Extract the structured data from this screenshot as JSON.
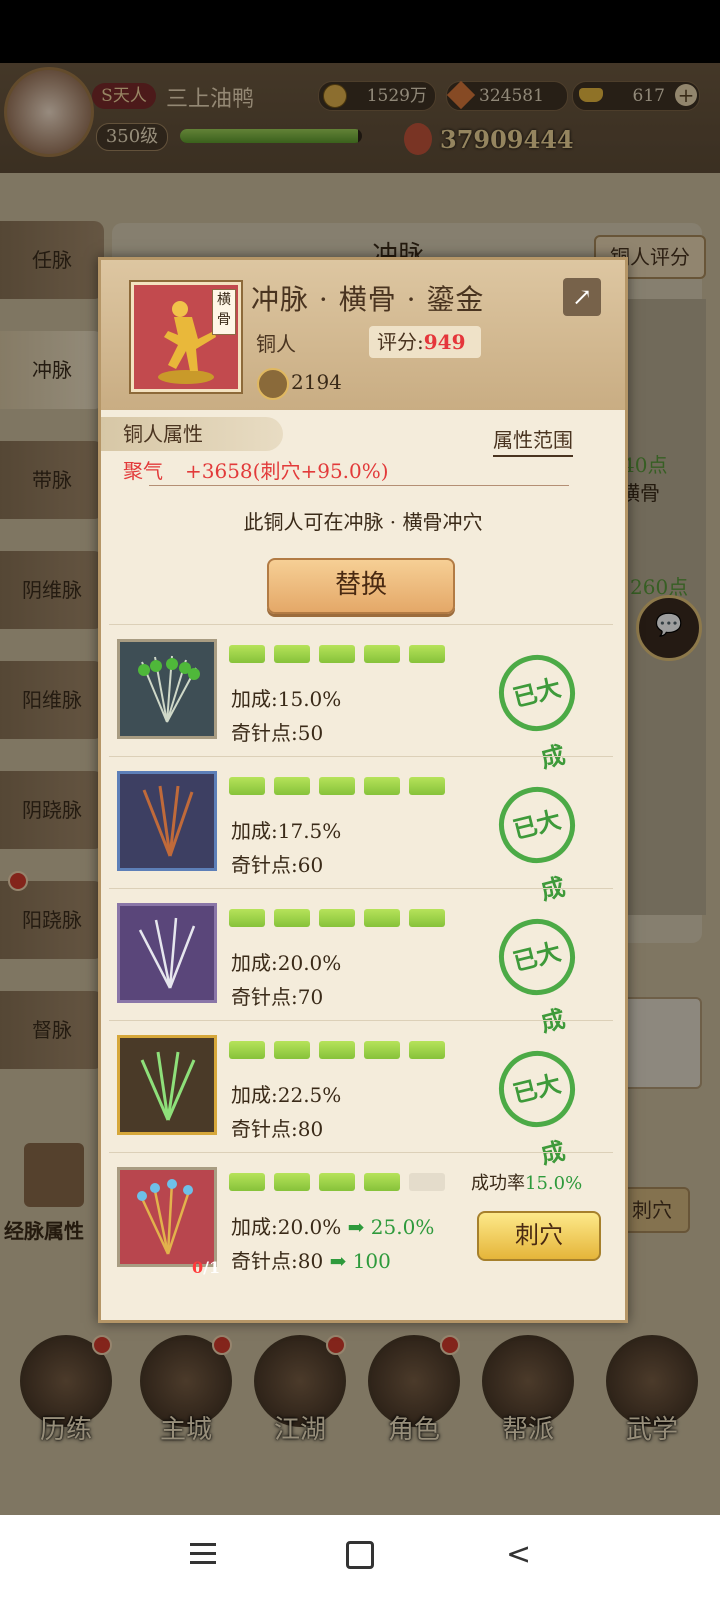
{
  "header": {
    "vip_label": "S天人",
    "player_name": "三上油鸭",
    "level": "350级",
    "power": "37909444",
    "level_progress": 0.98
  },
  "currencies": {
    "coins": "1529万",
    "gems": "324581",
    "gold": "617"
  },
  "side_tabs": [
    "任脉",
    "冲脉",
    "带脉",
    "阴维脉",
    "阳维脉",
    "阴跷脉",
    "阳跷脉",
    "督脉"
  ],
  "background": {
    "panel_title": "冲脉",
    "rating_button": "铜人评分",
    "meridian_attr": "经脉属性",
    "bg_points_1": "40点",
    "bg_label_1": "横骨",
    "bg_points_2": "260点",
    "bg_pierce": "刺穴"
  },
  "bottom_nav": [
    "历练",
    "主城",
    "江湖",
    "角色",
    "帮派",
    "武学"
  ],
  "dialog": {
    "title": "冲脉 · 横骨 · 鎏金",
    "portrait_tag": "横骨",
    "type": "铜人",
    "score_label": "评分:",
    "score_value": "949",
    "item_count": "2194",
    "section_tab": "铜人属性",
    "range_link": "属性范围",
    "attr_name": "聚气",
    "attr_value": "+3658(刺穴+95.0%)",
    "note": "此铜人可在冲脉 · 横骨冲穴",
    "replace_button": "替换",
    "bonus_label": "加成:",
    "points_label": "奇针点:",
    "done_stamp": "已大成",
    "rows": [
      {
        "bonus": "15.0%",
        "points": "50",
        "filled": 5
      },
      {
        "bonus": "17.5%",
        "points": "60",
        "filled": 5
      },
      {
        "bonus": "20.0%",
        "points": "70",
        "filled": 5
      },
      {
        "bonus": "22.5%",
        "points": "80",
        "filled": 5
      }
    ],
    "last_row": {
      "bonus": "20.0%",
      "bonus_next": "25.0%",
      "points": "80",
      "points_next": "100",
      "filled": 4,
      "success_label": "成功率",
      "success_rate": "15.0%",
      "owned": "0",
      "needed": "/1",
      "pierce_button": "刺穴"
    }
  },
  "colors": {
    "score_red": "#e5363b",
    "attr_red": "#e23a3a",
    "done_green": "#3e9a3a"
  }
}
